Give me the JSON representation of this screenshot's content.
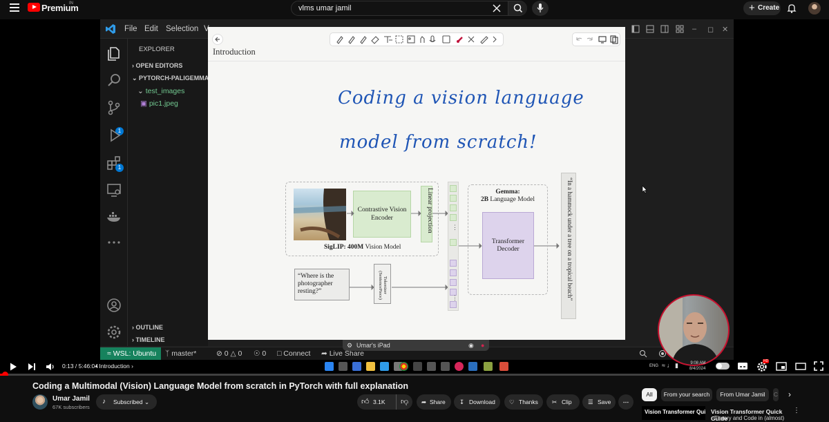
{
  "header": {
    "brand": "Premium",
    "brand_region": "IN",
    "search_value": "vlms umar jamil",
    "create_label": "Create"
  },
  "vscode": {
    "menu": [
      "File",
      "Edit",
      "Selection",
      "V"
    ],
    "explorer_title": "EXPLORER",
    "open_editors": "OPEN EDITORS",
    "project": "PYTORCH-PALIGEMMA",
    "folder": "test_images",
    "file": "pic1.jpeg",
    "outline": "OUTLINE",
    "timeline": "TIMELINE",
    "source_control_badge": "1",
    "extensions_badge": "1",
    "status": {
      "remote": "WSL: Ubuntu",
      "branch": "master*",
      "errors": "0",
      "warnings": "0",
      "ports": "0",
      "connect": "Connect",
      "live_share": "Live Share"
    }
  },
  "notes": {
    "section_title": "Introduction",
    "headline_line1": "Coding a vision language",
    "headline_line2": "model from scratch!",
    "vision_encoder": "Contrastive Vision Encoder",
    "linear_projection": "Linear projection",
    "siglip_bold": "SigLIP: 400M",
    "siglip_rest": " Vision Model",
    "prompt_text": "“Where is the photographer resting?”",
    "tokenizer": "Tokenizer (SentencePiece)",
    "gemma_title": "Gemma:",
    "gemma_bold": "2B",
    "gemma_rest": " Language Model",
    "decoder": "Transformer Decoder",
    "output_text": "“In a hammock under a tree on a tropical beach”",
    "ipad_label": "Umar's iPad"
  },
  "taskbar": {
    "lang": "ENG",
    "time": "9:08 AM",
    "date": "8/4/2024"
  },
  "player": {
    "current_time": "0:13",
    "duration": "5:46:04",
    "chapter": "Introduction",
    "progress": 0.006,
    "cc_badge": "HD"
  },
  "video": {
    "title": "Coding a Multimodal (Vision) Language Model from scratch in PyTorch with full explanation",
    "channel": "Umar Jamil",
    "subscribers": "67K subscribers",
    "subscribed_label": "Subscribed",
    "likes": "3.1K",
    "share": "Share",
    "download": "Download",
    "thanks": "Thanks",
    "clip": "Clip",
    "save": "Save"
  },
  "chips": [
    "All",
    "From your search",
    "From Umar Jamil",
    "C"
  ],
  "recommendation": {
    "thumb_text": "Vision Transformer Quick Guide",
    "title": "Vision Transformer Quick Guide",
    "subtitle": "- Theory and Code in (almost)"
  },
  "colors": {
    "youtube_red": "#ff0000",
    "vscode_remote": "#16825d",
    "ink_blue": "#1f55b5",
    "encoder_green": "#d9ebcf",
    "decoder_purple": "#ddd3ec"
  }
}
